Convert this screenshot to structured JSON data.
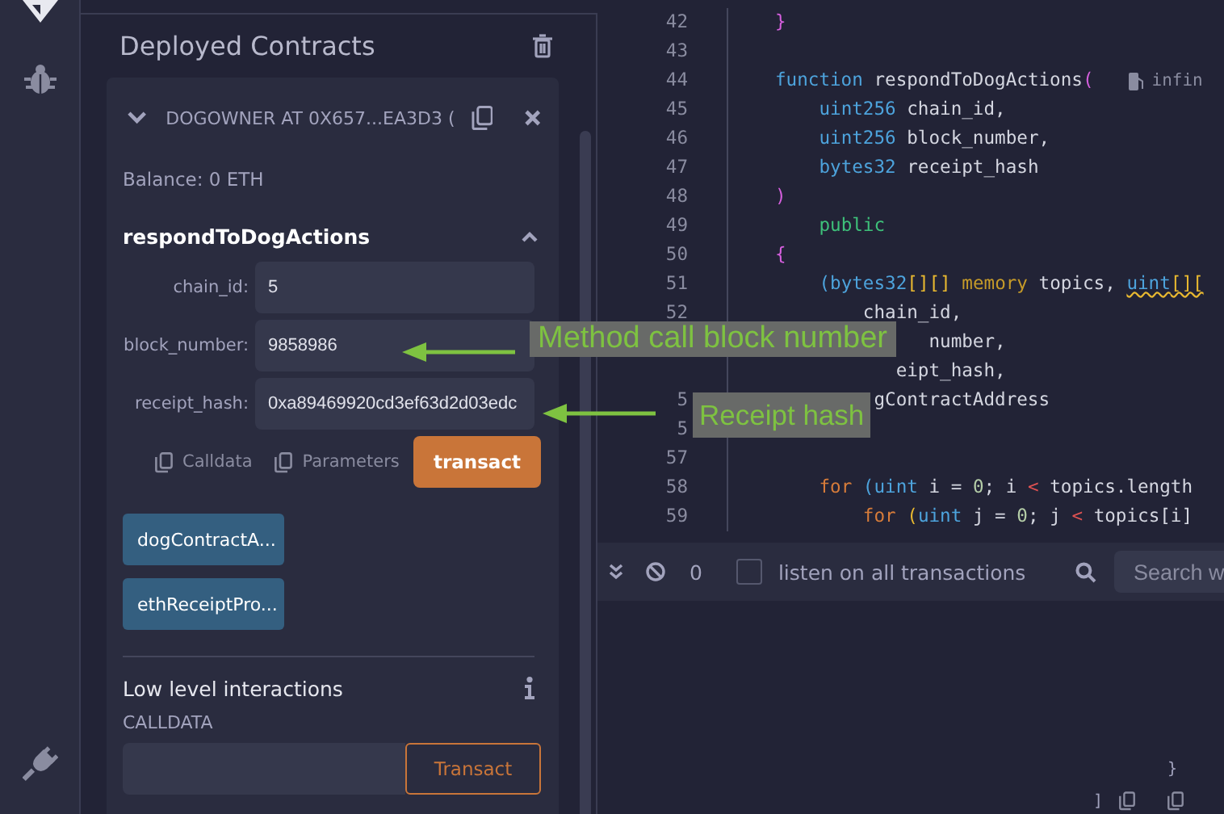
{
  "panel": {
    "title": "Deployed Contracts"
  },
  "contract": {
    "name": "DOGOWNER AT 0X657...EA3D3 (",
    "expanded": true,
    "balance": "Balance: 0 ETH",
    "function": {
      "name": "respondToDogActions",
      "expanded": true,
      "params": [
        {
          "label": "chain_id:",
          "value": "5"
        },
        {
          "label": "block_number:",
          "value": "9858986"
        },
        {
          "label": "receipt_hash:",
          "value": "0xa89469920cd3ef63d2d03edc"
        }
      ],
      "actions": [
        "Calldata",
        "Parameters"
      ],
      "submit": "transact"
    },
    "functions": [
      {
        "label": "dogContractA..."
      },
      {
        "label": "ethReceiptPro..."
      }
    ],
    "low_level": {
      "title": "Low level interactions",
      "calldata_label": "CALLDATA",
      "button": "Transact"
    }
  },
  "editor": {
    "lines": [
      {
        "number": "42",
        "tokens": [
          {
            "text": "}",
            "kind": "brace"
          }
        ]
      },
      {
        "number": "43"
      },
      {
        "number": "44",
        "tokens": [
          {
            "text": "function",
            "kind": "keyword"
          },
          {
            "text": " respondToDogActions",
            "kind": "plain"
          },
          {
            "text": "(",
            "kind": "brace"
          }
        ],
        "hint": "infin"
      },
      {
        "number": "45",
        "tokens": [
          {
            "text": "    uint256",
            "kind": "keyword"
          },
          {
            "text": " chain_id,",
            "kind": "plain"
          }
        ]
      },
      {
        "number": "46",
        "tokens": [
          {
            "text": "    uint256",
            "kind": "keyword"
          },
          {
            "text": " block_number,",
            "kind": "plain"
          }
        ]
      },
      {
        "number": "47",
        "tokens": [
          {
            "text": "    bytes32",
            "kind": "keyword"
          },
          {
            "text": " receipt_hash",
            "kind": "plain"
          }
        ]
      },
      {
        "number": "48",
        "tokens": [
          {
            "text": ")",
            "kind": "brace"
          }
        ]
      },
      {
        "number": "49",
        "tokens": [
          {
            "text": "    public",
            "kind": "modifier"
          }
        ]
      },
      {
        "number": "50",
        "tokens": [
          {
            "text": "{",
            "kind": "brace"
          }
        ]
      },
      {
        "number": "51",
        "tokens": [
          {
            "text": "    (bytes32",
            "kind": "keyword"
          },
          {
            "text": "[][]",
            "kind": "bracket"
          },
          {
            "text": " memory",
            "kind": "storage"
          },
          {
            "text": " topics, ",
            "kind": "plain"
          },
          {
            "text": "uint",
            "kind": "keyword",
            "warning": true
          },
          {
            "text": "[][",
            "kind": "bracket",
            "warning": true
          }
        ]
      },
      {
        "number": "52",
        "tokens": [
          {
            "text": "        chain_id,",
            "kind": "plain"
          }
        ]
      },
      {
        "tokens": [
          {
            "text": "              number,",
            "kind": "plain"
          }
        ]
      },
      {
        "tokens": [
          {
            "text": "           eipt_hash,",
            "kind": "plain"
          }
        ]
      },
      {
        "number": "5",
        "tokens": [
          {
            "text": "         gContractAddress",
            "kind": "plain"
          }
        ]
      },
      {
        "number": "5"
      },
      {
        "number": "57"
      },
      {
        "number": "58",
        "tokens": [
          {
            "text": "    for",
            "kind": "control"
          },
          {
            "text": " (uint",
            "kind": "keyword"
          },
          {
            "text": " i = ",
            "kind": "plain"
          },
          {
            "text": "0",
            "kind": "number"
          },
          {
            "text": "; i ",
            "kind": "plain"
          },
          {
            "text": "<",
            "kind": "operator"
          },
          {
            "text": " topics.length",
            "kind": "plain"
          }
        ]
      },
      {
        "number": "59",
        "tokens": [
          {
            "text": "        for",
            "kind": "control"
          },
          {
            "text": " (",
            "kind": "bracket"
          },
          {
            "text": "uint",
            "kind": "keyword"
          },
          {
            "text": " j = ",
            "kind": "plain"
          },
          {
            "text": "0",
            "kind": "number"
          },
          {
            "text": "; j ",
            "kind": "plain"
          },
          {
            "text": "<",
            "kind": "operator"
          },
          {
            "text": " topics[i]",
            "kind": "plain"
          }
        ]
      }
    ]
  },
  "terminal": {
    "count": "0",
    "listen": {
      "label": "listen on all transactions",
      "checked": false
    },
    "search": {
      "placeholder": "Search w"
    },
    "output": [
      "}",
      "]"
    ]
  },
  "annotations": [
    {
      "text": "Method call block number"
    },
    {
      "text": "Receipt hash"
    }
  ]
}
